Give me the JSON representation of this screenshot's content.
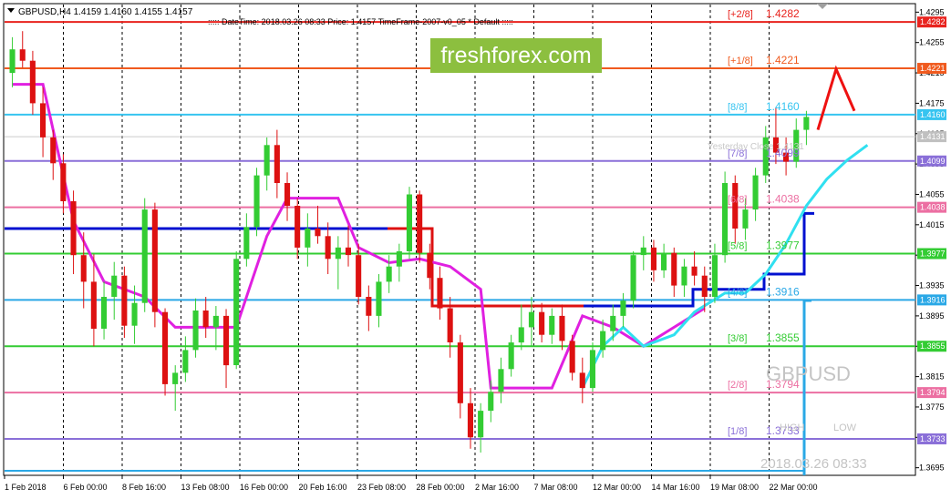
{
  "header": {
    "symbol_line": "GBPUSD,H4  1.4159 1.4160 1.4155 1.4157",
    "info_line": "::::: DateTime: 2018.03.26 08:33    Price: 1.4157    TimeFrame-2007-v0_05    *  Default    :::::"
  },
  "watermark": {
    "text": "freshforex.com",
    "bg": "#8cbf3f"
  },
  "overlay": {
    "symbol": "GBPUSD",
    "high": "HIGH",
    "low": "LOW",
    "datetime": "2018.03.26 08:33",
    "yesterday": "Yesterday Close 1.4131"
  },
  "chart_data": {
    "type": "candlestick",
    "title": "GBPUSD,H4",
    "ylim": [
      1.3685,
      1.4305
    ],
    "y_ticks": [
      "1.4295",
      "1.4255",
      "1.4215",
      "1.4175",
      "1.4135",
      "1.4095",
      "1.4055",
      "1.4015",
      "1.3975",
      "1.3935",
      "1.3895",
      "1.3855",
      "1.3815",
      "1.3775",
      "1.3735",
      "1.3695"
    ],
    "x_ticks": [
      "1 Feb 2018",
      "6 Feb 00:00",
      "8 Feb 16:00",
      "13 Feb 08:00",
      "16 Feb 00:00",
      "20 Feb 16:00",
      "23 Feb 08:00",
      "28 Feb 00:00",
      "2 Mar 16:00",
      "7 Mar 08:00",
      "12 Mar 00:00",
      "14 Mar 16:00",
      "19 Mar 08:00",
      "22 Mar 00:00"
    ],
    "murrey_levels": [
      {
        "label": "[+2/8]",
        "value": "1.4282",
        "price": 1.4282,
        "color": "#e8231e"
      },
      {
        "label": "[+1/8]",
        "value": "1.4221",
        "price": 1.4221,
        "color": "#f05a1e"
      },
      {
        "label": "[8/8]",
        "value": "1.4160",
        "price": 1.416,
        "color": "#36c4f0"
      },
      {
        "label": "[7/8]",
        "value": "1.4099",
        "price": 1.4099,
        "color": "#8a6fd8"
      },
      {
        "label": "[6/8]",
        "value": "1.4038",
        "price": 1.4038,
        "color": "#ec6fa2"
      },
      {
        "label": "[5/8]",
        "value": "1.3977",
        "price": 1.3977,
        "color": "#33cc33"
      },
      {
        "label": "[4/8]",
        "value": "1.3916",
        "price": 1.3916,
        "color": "#2aa8e6"
      },
      {
        "label": "[3/8]",
        "value": "1.3855",
        "price": 1.3855,
        "color": "#33cc33"
      },
      {
        "label": "[2/8]",
        "value": "1.3794",
        "price": 1.3794,
        "color": "#ec6fa2"
      },
      {
        "label": "[1/8]",
        "value": "1.3733",
        "price": 1.3733,
        "color": "#8a6fd8"
      }
    ],
    "price_labels": [
      {
        "value": "1.4282",
        "price": 1.4282,
        "color": "#e8231e"
      },
      {
        "value": "1.4221",
        "price": 1.4221,
        "color": "#f05a1e"
      },
      {
        "value": "1.4160",
        "price": 1.416,
        "color": "#36c4f0"
      },
      {
        "value": "1.4131",
        "price": 1.4131,
        "color": "#c0c0c0"
      },
      {
        "value": "1.4099",
        "price": 1.4099,
        "color": "#8a6fd8"
      },
      {
        "value": "1.4038",
        "price": 1.4038,
        "color": "#ec6fa2"
      },
      {
        "value": "1.3977",
        "price": 1.3977,
        "color": "#33cc33"
      },
      {
        "value": "1.3916",
        "price": 1.3916,
        "color": "#2aa8e6"
      },
      {
        "value": "1.3855",
        "price": 1.3855,
        "color": "#33cc33"
      },
      {
        "value": "1.3794",
        "price": 1.3794,
        "color": "#ec6fa2"
      },
      {
        "value": "1.3733",
        "price": 1.3733,
        "color": "#8a6fd8"
      }
    ],
    "colors": {
      "up": "#33cc33",
      "down": "#dd1111",
      "magenta": "#e020e0",
      "cyan": "#30e0f0",
      "red_step": "#dd1111",
      "blue_step": "#0010d0",
      "grid": "#000000"
    },
    "candles": [
      [
        1.4215,
        1.4262,
        1.4196,
        1.4246
      ],
      [
        1.4246,
        1.427,
        1.4222,
        1.4231
      ],
      [
        1.4231,
        1.4244,
        1.416,
        1.4175
      ],
      [
        1.4175,
        1.4196,
        1.4104,
        1.413
      ],
      [
        1.413,
        1.414,
        1.4074,
        1.4096
      ],
      [
        1.4096,
        1.4108,
        1.403,
        1.4046
      ],
      [
        1.4046,
        1.406,
        1.395,
        1.3975
      ],
      [
        1.3975,
        1.4005,
        1.3905,
        1.394
      ],
      [
        1.394,
        1.3976,
        1.3855,
        1.3878
      ],
      [
        1.3878,
        1.394,
        1.3864,
        1.392
      ],
      [
        1.392,
        1.3966,
        1.389,
        1.3948
      ],
      [
        1.3948,
        1.396,
        1.3866,
        1.3882
      ],
      [
        1.3882,
        1.3935,
        1.3858,
        1.3912
      ],
      [
        1.3912,
        1.405,
        1.39,
        1.4035
      ],
      [
        1.4035,
        1.4044,
        1.388,
        1.39
      ],
      [
        1.39,
        1.3905,
        1.379,
        1.3805
      ],
      [
        1.3805,
        1.383,
        1.377,
        1.382
      ],
      [
        1.382,
        1.3868,
        1.3808,
        1.385
      ],
      [
        1.385,
        1.3918,
        1.384,
        1.3902
      ],
      [
        1.3902,
        1.392,
        1.3866,
        1.388
      ],
      [
        1.388,
        1.3908,
        1.385,
        1.3895
      ],
      [
        1.3895,
        1.3904,
        1.38,
        1.383
      ],
      [
        1.383,
        1.398,
        1.3825,
        1.397
      ],
      [
        1.397,
        1.403,
        1.396,
        1.4012
      ],
      [
        1.4012,
        1.409,
        1.4,
        1.408
      ],
      [
        1.408,
        1.413,
        1.406,
        1.412
      ],
      [
        1.412,
        1.414,
        1.405,
        1.407
      ],
      [
        1.407,
        1.4084,
        1.402,
        1.404
      ],
      [
        1.404,
        1.405,
        1.397,
        1.3985
      ],
      [
        1.3985,
        1.403,
        1.396,
        1.401
      ],
      [
        1.401,
        1.404,
        1.399,
        1.4
      ],
      [
        1.4,
        1.4018,
        1.395,
        1.397
      ],
      [
        1.397,
        1.4,
        1.393,
        1.3985
      ],
      [
        1.3985,
        1.4014,
        1.396,
        1.3975
      ],
      [
        1.3975,
        1.399,
        1.391,
        1.392
      ],
      [
        1.392,
        1.3935,
        1.3875,
        1.3895
      ],
      [
        1.3895,
        1.395,
        1.388,
        1.394
      ],
      [
        1.394,
        1.3975,
        1.3925,
        1.396
      ],
      [
        1.396,
        1.399,
        1.394,
        1.398
      ],
      [
        1.398,
        1.4065,
        1.397,
        1.4055
      ],
      [
        1.4055,
        1.406,
        1.3965,
        1.3978
      ],
      [
        1.3978,
        1.399,
        1.393,
        1.3945
      ],
      [
        1.3945,
        1.396,
        1.389,
        1.3905
      ],
      [
        1.3905,
        1.392,
        1.384,
        1.386
      ],
      [
        1.386,
        1.387,
        1.376,
        1.378
      ],
      [
        1.378,
        1.38,
        1.372,
        1.3735
      ],
      [
        1.3735,
        1.378,
        1.3715,
        1.377
      ],
      [
        1.377,
        1.381,
        1.3755,
        1.3795
      ],
      [
        1.3795,
        1.384,
        1.378,
        1.3825
      ],
      [
        1.3825,
        1.387,
        1.3815,
        1.386
      ],
      [
        1.386,
        1.391,
        1.385,
        1.388
      ],
      [
        1.388,
        1.392,
        1.3855,
        1.39
      ],
      [
        1.39,
        1.3912,
        1.386,
        1.387
      ],
      [
        1.387,
        1.3905,
        1.3858,
        1.3895
      ],
      [
        1.3895,
        1.391,
        1.385,
        1.3862
      ],
      [
        1.3862,
        1.387,
        1.381,
        1.382
      ],
      [
        1.382,
        1.384,
        1.378,
        1.38
      ],
      [
        1.38,
        1.386,
        1.3795,
        1.385
      ],
      [
        1.385,
        1.389,
        1.384,
        1.3875
      ],
      [
        1.3875,
        1.391,
        1.3862,
        1.3895
      ],
      [
        1.3895,
        1.3925,
        1.388,
        1.3915
      ],
      [
        1.3915,
        1.398,
        1.3905,
        1.3975
      ],
      [
        1.3975,
        1.4,
        1.3955,
        1.3985
      ],
      [
        1.3985,
        1.3995,
        1.394,
        1.3955
      ],
      [
        1.3955,
        1.399,
        1.3945,
        1.3978
      ],
      [
        1.3978,
        1.3985,
        1.392,
        1.3935
      ],
      [
        1.3935,
        1.397,
        1.392,
        1.396
      ],
      [
        1.396,
        1.398,
        1.3935,
        1.3948
      ],
      [
        1.3948,
        1.396,
        1.39,
        1.392
      ],
      [
        1.392,
        1.399,
        1.3912,
        1.3975
      ],
      [
        1.3975,
        1.4085,
        1.3965,
        1.407
      ],
      [
        1.407,
        1.408,
        1.399,
        1.401
      ],
      [
        1.401,
        1.405,
        1.3995,
        1.4035
      ],
      [
        1.4035,
        1.409,
        1.402,
        1.408
      ],
      [
        1.408,
        1.4145,
        1.407,
        1.413
      ],
      [
        1.413,
        1.417,
        1.4095,
        1.411
      ],
      [
        1.411,
        1.413,
        1.408,
        1.4098
      ],
      [
        1.4098,
        1.4155,
        1.409,
        1.414
      ],
      [
        1.414,
        1.4165,
        1.412,
        1.4157
      ]
    ],
    "magenta_line": [
      [
        0,
        1.42
      ],
      [
        3,
        1.42
      ],
      [
        6,
        1.402
      ],
      [
        9,
        1.394
      ],
      [
        13,
        1.392
      ],
      [
        16,
        1.388
      ],
      [
        20,
        1.388
      ],
      [
        22,
        1.388
      ],
      [
        25,
        1.4
      ],
      [
        27,
        1.405
      ],
      [
        32,
        1.405
      ],
      [
        34,
        1.3985
      ],
      [
        37,
        1.3965
      ],
      [
        40,
        1.397
      ],
      [
        43,
        1.396
      ],
      [
        46,
        1.393
      ],
      [
        47,
        1.38
      ],
      [
        49,
        1.38
      ],
      [
        53,
        1.38
      ],
      [
        56,
        1.3895
      ],
      [
        59,
        1.388
      ],
      [
        62,
        1.3855
      ],
      [
        65,
        1.388
      ],
      [
        68,
        1.3905
      ]
    ],
    "cyan_line": [
      [
        56,
        1.38
      ],
      [
        58,
        1.3855
      ],
      [
        60,
        1.388
      ],
      [
        62,
        1.3855
      ],
      [
        65,
        1.387
      ],
      [
        67,
        1.39
      ],
      [
        70,
        1.3925
      ],
      [
        72,
        1.3925
      ],
      [
        74,
        1.395
      ],
      [
        76,
        1.399
      ],
      [
        78,
        1.404
      ],
      [
        80,
        1.4075
      ],
      [
        82,
        1.41
      ],
      [
        84,
        1.412
      ]
    ],
    "forecast_line": [
      [
        1.414,
        0
      ],
      [
        1.422,
        1
      ],
      [
        1.4165,
        2
      ]
    ]
  }
}
